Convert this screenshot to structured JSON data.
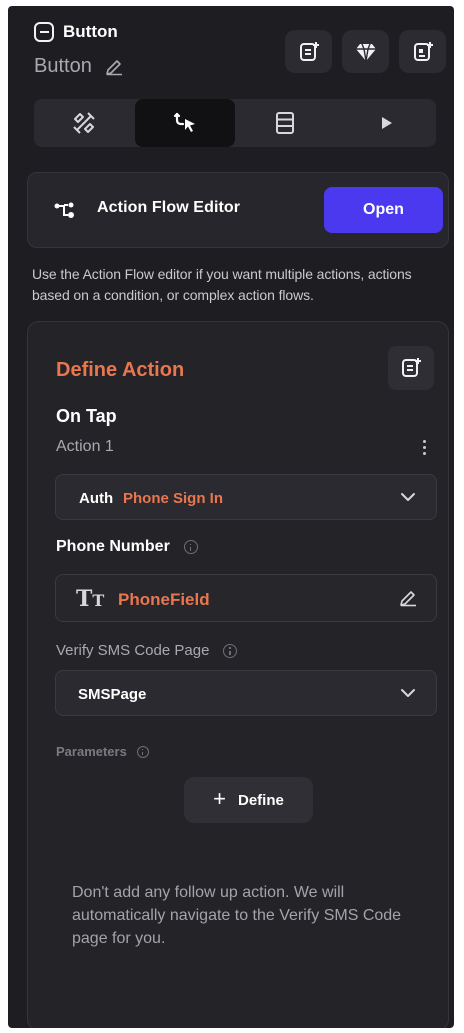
{
  "header": {
    "widget_type": "Button",
    "widget_name": "Button",
    "actions": [
      {
        "icon": "document-add-icon"
      },
      {
        "icon": "diamond-icon"
      },
      {
        "icon": "component-add-icon"
      }
    ]
  },
  "tabs": [
    {
      "icon": "properties-icon",
      "active": false
    },
    {
      "icon": "actions-icon",
      "active": true
    },
    {
      "icon": "backend-query-icon",
      "active": false
    },
    {
      "icon": "play-icon",
      "active": false
    }
  ],
  "action_flow": {
    "title": "Action Flow Editor",
    "open_label": "Open",
    "help": "Use the Action Flow editor if you want multiple actions, actions based on a condition, or complex action flows."
  },
  "define_action": {
    "title": "Define Action",
    "trigger": "On Tap",
    "action_label": "Action 1",
    "action_prefix": "Auth",
    "action_value": "Phone Sign In",
    "phone_label": "Phone Number",
    "phone_value": "PhoneField",
    "sms_label": "Verify SMS Code Page",
    "sms_value": "SMSPage",
    "params_label": "Parameters",
    "define_label": "Define",
    "note": "Don't add any follow up action. We will automatically navigate to the Verify SMS Code page for you."
  },
  "colors": {
    "accent": "#4b39ef",
    "highlight": "#e9764e",
    "panel_bg": "#1d1d22"
  }
}
